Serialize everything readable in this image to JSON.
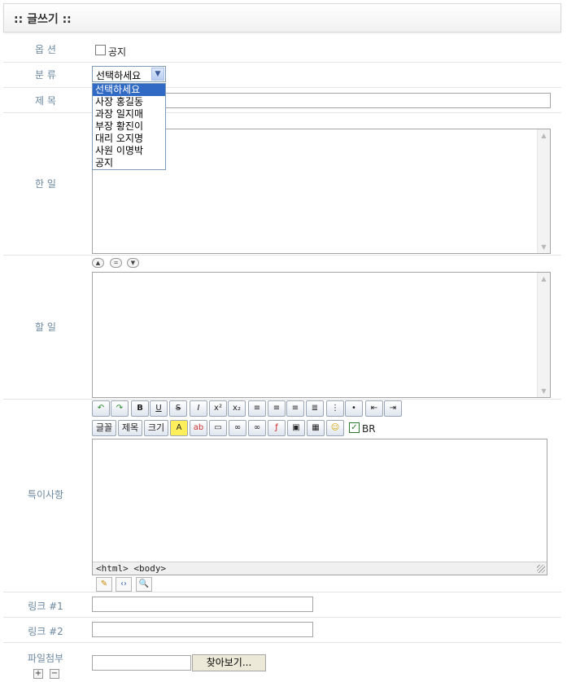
{
  "header": {
    "title": ":: 글쓰기 ::"
  },
  "labels": {
    "option": "옵 션",
    "category": "분 류",
    "subject": "제 목",
    "done": "한 일",
    "todo": "할 일",
    "notes": "특이사항",
    "link1": "링크 #1",
    "link2": "링크 #2",
    "attach": "파일첨부"
  },
  "option": {
    "notice_label": "공지",
    "notice_checked": false
  },
  "category": {
    "selected": "선택하세요",
    "options": [
      "선택하세요",
      "사장 홍길동",
      "과장 일지매",
      "부장 황진이",
      "대리 오지명",
      "사원 이명박",
      "공지"
    ]
  },
  "editor": {
    "toolbar_row2_text": [
      "글꼴",
      "제목",
      "크기"
    ],
    "br_label": "BR",
    "br_checked": true,
    "status": "<html> <body>"
  },
  "attach": {
    "browse_label": "찾아보기..."
  }
}
